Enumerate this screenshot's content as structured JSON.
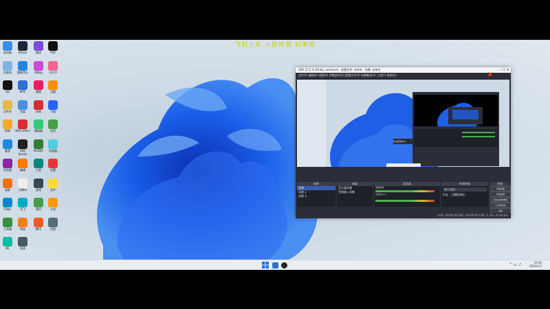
{
  "marquee_text": "飞机上车 火箭房管 利率低",
  "desktop": {
    "icons": [
      {
        "name": "computer-icon",
        "label": "此电脑",
        "color": "#3a8ee6"
      },
      {
        "name": "steam-icon",
        "label": "Steam",
        "color": "#1b2838"
      },
      {
        "name": "app3-icon",
        "label": "微信",
        "color": "#7b4cd9"
      },
      {
        "name": "app4-icon",
        "label": "MW",
        "color": "#111111"
      },
      {
        "name": "recycle-icon",
        "label": "回收站",
        "color": "#7fb3e6"
      },
      {
        "name": "kugou-icon",
        "label": "酷狗音乐",
        "color": "#1e88e5"
      },
      {
        "name": "app7-icon",
        "label": "网易云",
        "color": "#ce4bd9"
      },
      {
        "name": "app8-icon",
        "label": "小红书",
        "color": "#f06292"
      },
      {
        "name": "qq-icon",
        "label": "QQ",
        "color": "#111111"
      },
      {
        "name": "app10-icon",
        "label": "WPS",
        "color": "#2f6fd6"
      },
      {
        "name": "app11-icon",
        "label": "美图",
        "color": "#e91e63"
      },
      {
        "name": "app12-icon",
        "label": "迅雷",
        "color": "#ff8f00"
      },
      {
        "name": "folder-icon",
        "label": "文件夹",
        "color": "#e8b84a"
      },
      {
        "name": "app14-icon",
        "label": "百度",
        "color": "#4a90e2"
      },
      {
        "name": "app15-icon",
        "label": "网易",
        "color": "#d32f2f"
      },
      {
        "name": "app16-icon",
        "label": "下载",
        "color": "#2962ff"
      },
      {
        "name": "app17-icon",
        "label": "剪映",
        "color": "#f9a825"
      },
      {
        "name": "wps-icon",
        "label": "WPS Office",
        "color": "#d32f2f"
      },
      {
        "name": "app19-icon",
        "label": "播放器",
        "color": "#2ecc71"
      },
      {
        "name": "app20-icon",
        "label": "应用",
        "color": "#43a047"
      },
      {
        "name": "app21-icon",
        "label": "截图",
        "color": "#1e88e5"
      },
      {
        "name": "obs-icon",
        "label": "OBS Studio",
        "color": "#222222"
      },
      {
        "name": "nvidia-icon",
        "label": "NVIDIA",
        "color": "#2e7d32"
      },
      {
        "name": "app24-icon",
        "label": "加速器",
        "color": "#4dd0e1"
      },
      {
        "name": "app25-icon",
        "label": "浏览器",
        "color": "#8e24aa"
      },
      {
        "name": "app26-icon",
        "label": "编辑",
        "color": "#f57c00"
      },
      {
        "name": "app27-icon",
        "label": "工具",
        "color": "#00897b"
      },
      {
        "name": "app28-icon",
        "label": "设置",
        "color": "#e53935"
      },
      {
        "name": "app29-icon",
        "label": "录屏",
        "color": "#ff6f00"
      },
      {
        "name": "app30-icon",
        "label": "记事本",
        "color": "#eeeeee"
      },
      {
        "name": "app31-icon",
        "label": "游戏",
        "color": "#37474f"
      },
      {
        "name": "app32-icon",
        "label": "文件",
        "color": "#fdd835"
      },
      {
        "name": "app33-icon",
        "label": "Edge",
        "color": "#0288d1"
      },
      {
        "name": "app34-icon",
        "label": "讯飞",
        "color": "#00acc1"
      },
      {
        "name": "app35-icon",
        "label": "相机",
        "color": "#43a047"
      },
      {
        "name": "app36-icon",
        "label": "斗鱼",
        "color": "#ff9800"
      },
      {
        "name": "app37-icon",
        "label": "工具箱",
        "color": "#388e3c"
      },
      {
        "name": "app38-icon",
        "label": "修复",
        "color": "#f57f17"
      },
      {
        "name": "app39-icon",
        "label": "腾讯",
        "color": "#ff5722"
      },
      {
        "name": "app40-icon",
        "label": "控制",
        "color": "#546e7a"
      },
      {
        "name": "app41-icon",
        "label": "BE",
        "color": "#00bfa5"
      },
      {
        "name": "app42-icon",
        "label": "电源",
        "color": "#455a64"
      }
    ]
  },
  "obs": {
    "title": "OBS 27.2.4 (64-bit, windows) - 配置文件: 未命名 - 场景: 未命名",
    "menu": "文件(F)  编辑(E)  视图(V)  停靠部件(D)  配置文件(P)  场景集合(S)  工具(T)  帮助(H)",
    "panels": {
      "scenes": "场景",
      "sources": "来源",
      "mixer": "混音器",
      "transitions": "转场特效",
      "controls": "控制"
    },
    "scenes_list": [
      "场景",
      "场景 2",
      "场景 3"
    ],
    "sources_list": [
      "显示器采集",
      "音频输入采集"
    ],
    "mixer_tracks": [
      "桌面音频",
      "麦克风/Aux"
    ],
    "transition_label": "淡入淡出",
    "duration_label": "时长",
    "duration_value": "300 ms",
    "buttons": [
      "开始直播",
      "开始录制",
      "启动虚拟摄像机",
      "工作室模式",
      "设置",
      "退出"
    ],
    "status": "LIVE: 00:00:00   REC: 00:00:00   CPU: 1.3%, 30.00 fps",
    "preview_badge": "欢迎使用OBS",
    "nested_preview": "屏幕预览"
  },
  "taskbar": {
    "time": "10:06",
    "date": "2024/1/3"
  }
}
